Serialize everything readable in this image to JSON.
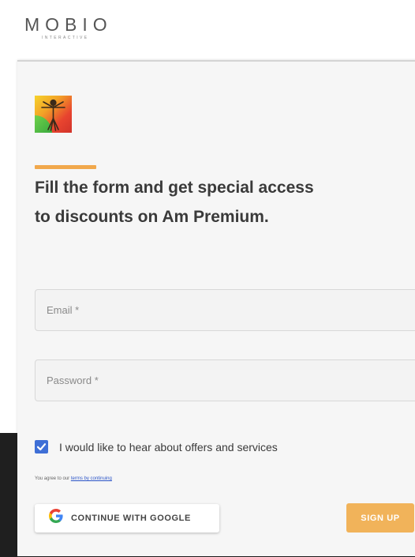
{
  "header": {
    "logo_text": "MOBIO",
    "logo_subtext": "INTERACTIVE"
  },
  "app_icon": "vitruvian-man-app-icon",
  "form": {
    "headline": "Fill the form and get special access to discounts on Am Premium.",
    "email": {
      "placeholder": "Email *",
      "value": ""
    },
    "password": {
      "placeholder": "Password *",
      "value": ""
    },
    "consent": {
      "label": "I would like to hear about offers and services",
      "checked": true
    },
    "terms": {
      "prefix": "You agree to our ",
      "link_text": "terms by continuing"
    },
    "google_button_label": "CONTINUE WITH GOOGLE",
    "signup_button_label": "SIGN UP"
  },
  "colors": {
    "accent": "#f1a84c",
    "signup": "#f1b35a",
    "checkbox": "#3f6fd6",
    "link": "#2c55c8",
    "card_background": "#f6f6f6"
  }
}
